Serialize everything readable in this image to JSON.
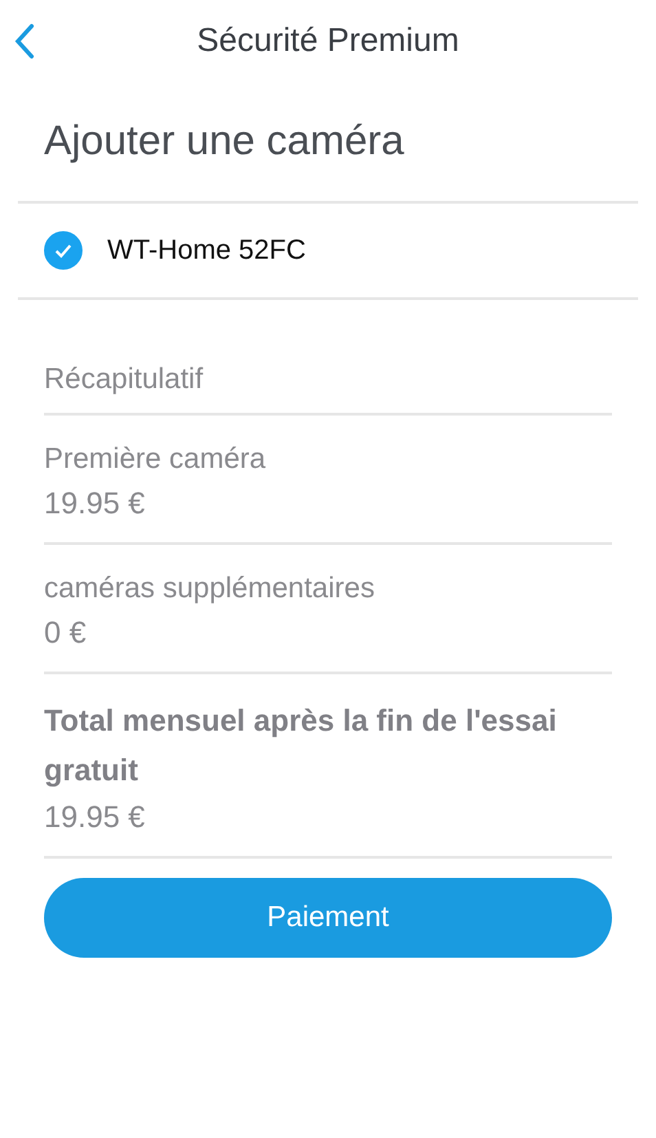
{
  "header": {
    "title": "Sécurité Premium"
  },
  "heading": "Ajouter une caméra",
  "cameras": [
    {
      "name": "WT-Home 52FC",
      "checked": true
    }
  ],
  "summary": {
    "title": "Récapitulatif",
    "items": [
      {
        "kind": "plain",
        "label": "Première caméra",
        "value": "19.95 €"
      },
      {
        "kind": "plain",
        "label": "caméras supplémentaires",
        "value": "0 €"
      },
      {
        "kind": "bold",
        "label": "Total mensuel après la fin de l'essai gratuit",
        "value": "19.95 €"
      }
    ]
  },
  "button": "Paiement"
}
